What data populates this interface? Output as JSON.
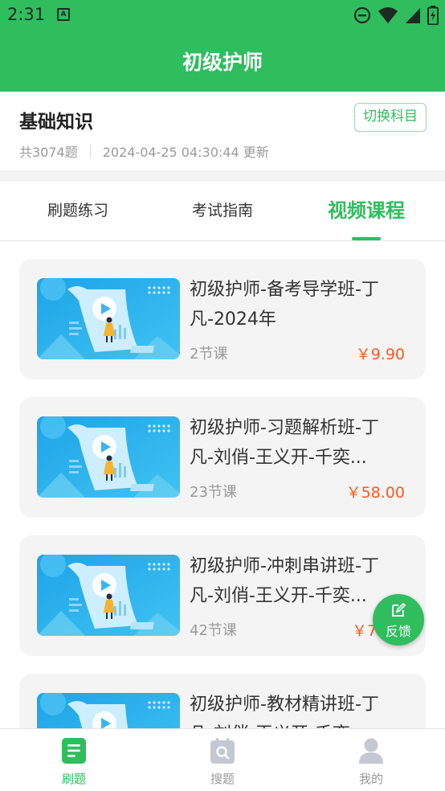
{
  "status": {
    "time": "2:31",
    "a_badge": "A"
  },
  "header": {
    "title": "初级护师"
  },
  "subject": {
    "title": "基础知识",
    "switch_label": "切换科目",
    "count": "共3074题",
    "updated": "2024-04-25 04:30:44 更新"
  },
  "tabs": [
    {
      "label": "刷题练习",
      "active": false
    },
    {
      "label": "考试指南",
      "active": false
    },
    {
      "label": "视频课程",
      "active": true
    }
  ],
  "courses": [
    {
      "title": "初级护师-备考导学班-丁凡-2024年",
      "lessons": "2节课",
      "price": "￥9.90"
    },
    {
      "title": "初级护师-习题解析班-丁凡-刘俏-王义开-千奕...",
      "lessons": "23节课",
      "price": "￥58.00"
    },
    {
      "title": "初级护师-冲刺串讲班-丁凡-刘俏-王义开-千奕...",
      "lessons": "42节课",
      "price": "￥7"
    },
    {
      "title": "初级护师-教材精讲班-丁凡-刘俏-王义开-千奕...",
      "lessons": "",
      "price": ""
    }
  ],
  "feedback": {
    "label": "反馈"
  },
  "bottom_nav": [
    {
      "label": "刷题",
      "icon": "doc-icon",
      "active": true
    },
    {
      "label": "搜题",
      "icon": "search-icon",
      "active": false
    },
    {
      "label": "我的",
      "icon": "user-icon",
      "active": false
    }
  ],
  "colors": {
    "primary": "#2fbd5e",
    "price": "#ff5a1f",
    "card_bg": "#f4f4f4"
  }
}
